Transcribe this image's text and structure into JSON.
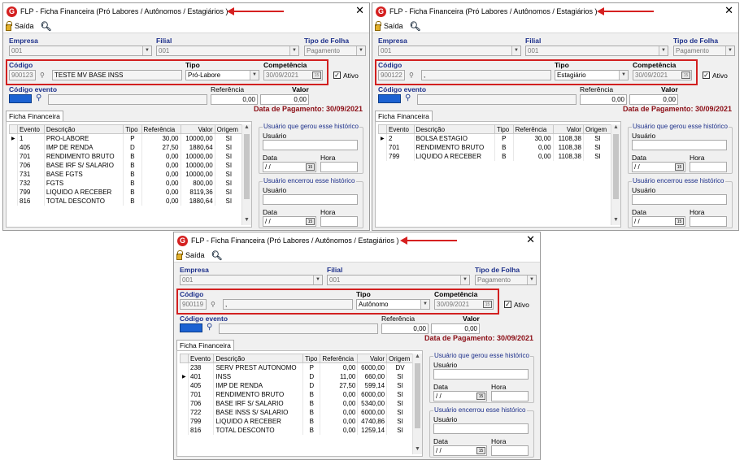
{
  "window_title": "FLP - Ficha Financeira (Pró Labores / Autônomos / Estagiários )",
  "toolbar": {
    "exit_label": "Saída"
  },
  "labels": {
    "empresa": "Empresa",
    "filial": "Filial",
    "tipo_folha": "Tipo de Folha",
    "codigo": "Código",
    "tipo": "Tipo",
    "competencia": "Competência",
    "ativo": "Ativo",
    "codigo_evento": "Código evento",
    "referencia": "Referência",
    "valor": "Valor",
    "tab": "Ficha Financeira",
    "usuario_gerou": "Usuário que gerou esse histórico",
    "usuario_encerrou": "Usuário encerrou esse histórico",
    "usuario": "Usuário",
    "data": "Data",
    "hora": "Hora",
    "date_placeholder": " / /"
  },
  "columns": [
    "Evento",
    "Descrição",
    "Tipo",
    "Referência",
    "Valor",
    "Origem"
  ],
  "windows": [
    {
      "empresa": "001",
      "filial": "001",
      "tipo_folha": "Pagamento",
      "codigo": "900123",
      "nome": "TESTE MV BASE INSS",
      "tipo": "Pró-Labore",
      "competencia": "30/09/2021",
      "ativo": "✓",
      "referencia": "0,00",
      "valor": "0,00",
      "data_pagamento": "Data de Pagamento: 30/09/2021",
      "rows": [
        {
          "evento": "1",
          "descricao": "PRO-LABORE",
          "tipo": "P",
          "referencia": "30,00",
          "valor": "10000,00",
          "origem": "SI",
          "current": "▶"
        },
        {
          "evento": "405",
          "descricao": "IMP DE RENDA",
          "tipo": "D",
          "referencia": "27,50",
          "valor": "1880,64",
          "origem": "SI"
        },
        {
          "evento": "701",
          "descricao": "RENDIMENTO BRUTO",
          "tipo": "B",
          "referencia": "0,00",
          "valor": "10000,00",
          "origem": "SI"
        },
        {
          "evento": "706",
          "descricao": "BASE IRF S/ SALARIO",
          "tipo": "B",
          "referencia": "0,00",
          "valor": "10000,00",
          "origem": "SI"
        },
        {
          "evento": "731",
          "descricao": "BASE FGTS",
          "tipo": "B",
          "referencia": "0,00",
          "valor": "10000,00",
          "origem": "SI"
        },
        {
          "evento": "732",
          "descricao": "FGTS",
          "tipo": "B",
          "referencia": "0,00",
          "valor": "800,00",
          "origem": "SI"
        },
        {
          "evento": "799",
          "descricao": "LIQUIDO A RECEBER",
          "tipo": "B",
          "referencia": "0,00",
          "valor": "8119,36",
          "origem": "SI"
        },
        {
          "evento": "816",
          "descricao": "TOTAL DESCONTO",
          "tipo": "B",
          "referencia": "0,00",
          "valor": "1880,64",
          "origem": "SI"
        }
      ]
    },
    {
      "empresa": "001",
      "filial": "001",
      "tipo_folha": "Pagamento",
      "codigo": "900122",
      "nome": ",",
      "tipo": "Estagiário",
      "competencia": "30/09/2021",
      "ativo": "✓",
      "referencia": "0,00",
      "valor": "0,00",
      "data_pagamento": "Data de Pagamento: 30/09/2021",
      "rows": [
        {
          "evento": "2",
          "descricao": "BOLSA ESTAGIO",
          "tipo": "P",
          "referencia": "30,00",
          "valor": "1108,38",
          "origem": "SI",
          "current": "▶"
        },
        {
          "evento": "701",
          "descricao": "RENDIMENTO BRUTO",
          "tipo": "B",
          "referencia": "0,00",
          "valor": "1108,38",
          "origem": "SI"
        },
        {
          "evento": "799",
          "descricao": "LIQUIDO A RECEBER",
          "tipo": "B",
          "referencia": "0,00",
          "valor": "1108,38",
          "origem": "SI"
        }
      ]
    },
    {
      "empresa": "001",
      "filial": "001",
      "tipo_folha": "Pagamento",
      "codigo": "900119",
      "nome": ",",
      "tipo": "Autônomo",
      "competencia": "30/09/2021",
      "ativo": "✓",
      "referencia": "0,00",
      "valor": "0,00",
      "data_pagamento": "Data de Pagamento: 30/09/2021",
      "rows": [
        {
          "evento": "238",
          "descricao": "SERV PREST AUTONOMO",
          "tipo": "P",
          "referencia": "0,00",
          "valor": "6000,00",
          "origem": "DV"
        },
        {
          "evento": "401",
          "descricao": "INSS",
          "tipo": "D",
          "referencia": "11,00",
          "valor": "660,00",
          "origem": "SI",
          "current": "▶"
        },
        {
          "evento": "405",
          "descricao": "IMP DE RENDA",
          "tipo": "D",
          "referencia": "27,50",
          "valor": "599,14",
          "origem": "SI"
        },
        {
          "evento": "701",
          "descricao": "RENDIMENTO BRUTO",
          "tipo": "B",
          "referencia": "0,00",
          "valor": "6000,00",
          "origem": "SI"
        },
        {
          "evento": "706",
          "descricao": "BASE IRF S/ SALARIO",
          "tipo": "B",
          "referencia": "0,00",
          "valor": "5340,00",
          "origem": "SI"
        },
        {
          "evento": "722",
          "descricao": "BASE INSS S/ SALARIO",
          "tipo": "B",
          "referencia": "0,00",
          "valor": "6000,00",
          "origem": "SI"
        },
        {
          "evento": "799",
          "descricao": "LIQUIDO A RECEBER",
          "tipo": "B",
          "referencia": "0,00",
          "valor": "4740,86",
          "origem": "SI"
        },
        {
          "evento": "816",
          "descricao": "TOTAL DESCONTO",
          "tipo": "B",
          "referencia": "0,00",
          "valor": "1259,14",
          "origem": "SI"
        }
      ]
    }
  ]
}
